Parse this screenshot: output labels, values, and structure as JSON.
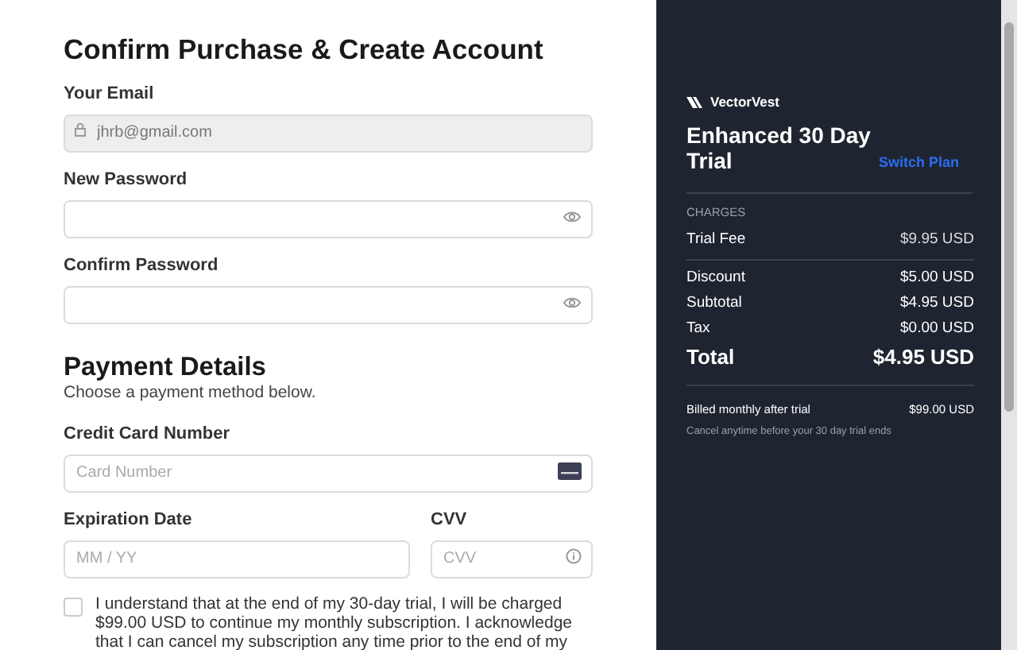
{
  "form": {
    "title": "Confirm Purchase & Create Account",
    "email": {
      "label": "Your Email",
      "value": "jhrb@gmail.com",
      "disabled": true
    },
    "new_password": {
      "label": "New Password"
    },
    "confirm_password": {
      "label": "Confirm Password"
    }
  },
  "payment": {
    "title": "Payment Details",
    "subtitle": "Choose a payment method below.",
    "card": {
      "label": "Credit Card Number",
      "placeholder": "Card Number"
    },
    "expiry": {
      "label": "Expiration Date",
      "placeholder": "MM / YY"
    },
    "cvv": {
      "label": "CVV",
      "placeholder": "CVV"
    },
    "agreement": {
      "checked": false,
      "text": "I understand that at the end of my 30-day trial, I will be charged $99.00 USD to continue my monthly subscription. I acknowledge that I can cancel my subscription any time prior to the end of my"
    }
  },
  "summary": {
    "brand": "VectorVest",
    "plan": "Enhanced 30 Day Trial",
    "switch_link": "Switch Plan",
    "section": "CHARGES",
    "charges": [
      {
        "label": "Trial Fee",
        "amount": "$9.95 USD"
      }
    ],
    "lines": [
      {
        "label": "Discount",
        "amount": "$5.00 USD",
        "kind": "normal"
      },
      {
        "label": "Subtotal",
        "amount": "$4.95 USD",
        "kind": "normal"
      },
      {
        "label": "Tax",
        "amount": "$0.00 USD",
        "kind": "normal"
      },
      {
        "label": "Total",
        "amount": "$4.95 USD",
        "kind": "total"
      }
    ],
    "billing": {
      "label": "Billed monthly after trial",
      "amount": "$99.00 USD",
      "note": "Cancel anytime before your 30 day trial ends"
    }
  }
}
